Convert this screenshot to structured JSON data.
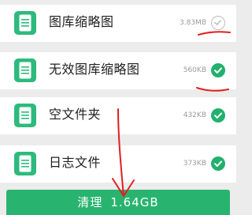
{
  "items": [
    {
      "title": "图库缩略图",
      "size": "3.83MB",
      "checked": false
    },
    {
      "title": "无效图库缩略图",
      "size": "560KB",
      "checked": true
    },
    {
      "title": "空文件夹",
      "size": "432KB",
      "checked": true
    },
    {
      "title": "日志文件",
      "size": "373KB",
      "checked": true
    }
  ],
  "clean_button": {
    "label": "清理",
    "amount": "1.64GB"
  },
  "colors": {
    "accent": "#28b46f",
    "icon_bg": "#2dba7c",
    "annotation": "#e02020"
  },
  "icons": {
    "file": "document-icon",
    "check": "checkmark-icon"
  }
}
